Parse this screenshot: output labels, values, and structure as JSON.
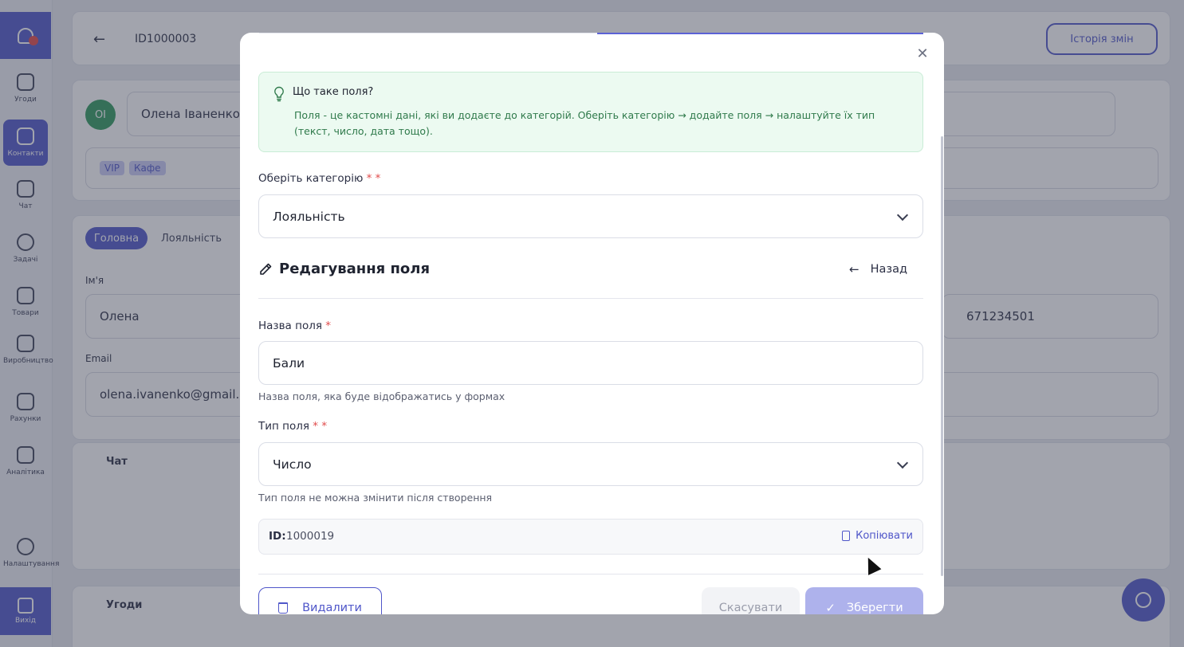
{
  "background": {
    "sidebar": {
      "items": [
        {
          "label": "Угоди"
        },
        {
          "label": "Контакти"
        },
        {
          "label": "Чат"
        },
        {
          "label": "Задачі"
        },
        {
          "label": "Товари"
        },
        {
          "label": "Виробництво"
        },
        {
          "label": "Рахунки"
        },
        {
          "label": "Аналітика"
        },
        {
          "label": "Налаштування"
        }
      ],
      "exit_label": "Вихід"
    },
    "header": {
      "record_id": "ID1000003",
      "history_button": "Історія змін"
    },
    "contact": {
      "avatar_initials": "ОІ",
      "name": "Олена Іваненко",
      "tags": [
        "VIP",
        "Кафе"
      ],
      "tabs": [
        "Головна",
        "Лояльність"
      ],
      "first_name_label": "Ім'я",
      "first_name_value": "Олена",
      "email_label": "Email",
      "email_value": "olena.ivanenko@gmail.co",
      "phone_value": "671234501"
    },
    "chat_card_title": "Чат",
    "deals_card_title": "Угоди"
  },
  "modal": {
    "info": {
      "title": "Що таке поля?",
      "text": "Поля - це кастомні дані, які ви додаєте до категорій. Оберіть категорію → додайте поля → налаштуйте їх тип (текст, число, дата тощо)."
    },
    "category": {
      "label": "Оберіть категорію",
      "required_mark": "* *",
      "value": "Лояльність"
    },
    "section": {
      "title": "Редагування поля",
      "back_label": "Назад"
    },
    "field_name": {
      "label": "Назва поля",
      "required_mark": "*",
      "value": "Бали",
      "hint": "Назва поля, яка буде відображатись у формах"
    },
    "field_type": {
      "label": "Тип поля",
      "required_mark": "* *",
      "value": "Число",
      "hint": "Тип поля не можна змінити після створення"
    },
    "id_box": {
      "label": "ID:",
      "value": "1000019",
      "copy_label": "Копіювати"
    },
    "actions": {
      "delete": "Видалити",
      "cancel": "Скасувати",
      "save": "Зберегти"
    }
  },
  "colors": {
    "accent": "#4f56c9",
    "info_bg": "#ecfaf1",
    "info_text": "#2f7a4b",
    "required": "#e14b4b"
  }
}
